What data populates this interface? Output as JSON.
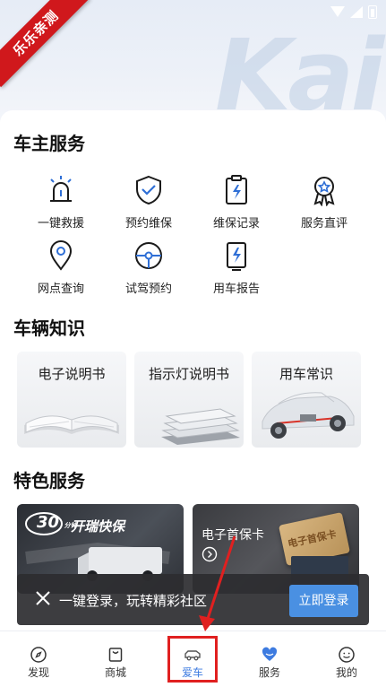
{
  "badge": {
    "text": "乐乐亲测"
  },
  "hero": {
    "watermark": "Kai"
  },
  "owner_services": {
    "title": "车主服务",
    "items": [
      {
        "label": "一键救援",
        "icon": "rescue-icon"
      },
      {
        "label": "预约维保",
        "icon": "shield-check-icon"
      },
      {
        "label": "维保记录",
        "icon": "maintenance-record-icon"
      },
      {
        "label": "服务直评",
        "icon": "award-icon"
      },
      {
        "label": "网点查询",
        "icon": "location-pin-icon"
      },
      {
        "label": "试驾预约",
        "icon": "steering-wheel-icon"
      },
      {
        "label": "用车报告",
        "icon": "report-icon"
      }
    ]
  },
  "vehicle_knowledge": {
    "title": "车辆知识",
    "cards": [
      {
        "label": "电子说明书"
      },
      {
        "label": "指示灯说明书"
      },
      {
        "label": "用车常识"
      }
    ]
  },
  "special_services": {
    "title": "特色服务",
    "cards": [
      {
        "label": "开瑞快保",
        "badge_number": "30",
        "badge_unit": "分钟"
      },
      {
        "label": "电子首保卡",
        "card_text": "电子首保卡"
      }
    ]
  },
  "toast": {
    "text": "一键登录，玩转精彩社区",
    "button": "立即登录"
  },
  "tabbar": {
    "tabs": [
      {
        "label": "发现",
        "icon": "compass-icon"
      },
      {
        "label": "商城",
        "icon": "shopping-bag-icon"
      },
      {
        "label": "爱车",
        "icon": "car-icon"
      },
      {
        "label": "服务",
        "icon": "heart-service-icon"
      },
      {
        "label": "我的",
        "icon": "smiley-icon"
      }
    ],
    "active_index": 2
  },
  "colors": {
    "accent": "#4a90e2",
    "ribbon": "#d0181c",
    "icon_blue": "#2f6fd6"
  }
}
